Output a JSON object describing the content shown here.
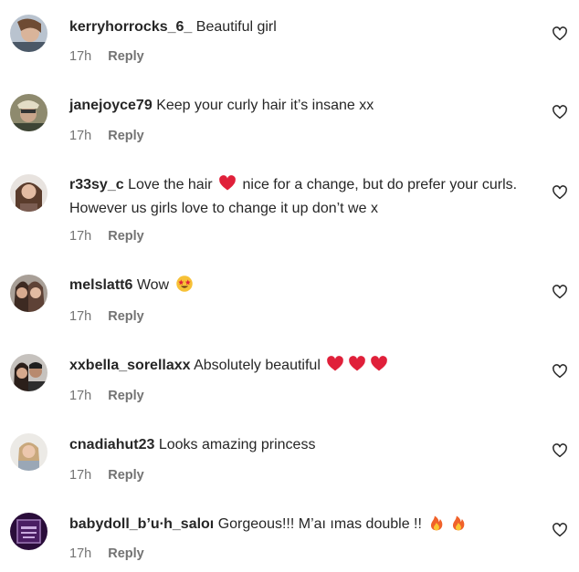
{
  "comments": [
    {
      "username": "kerryhorrocks_6_",
      "text": "Beautiful girl",
      "time": "17h",
      "reply_label": "Reply",
      "avatar_icon": "profile-photo",
      "like_icon": "heart-outline-icon"
    },
    {
      "username": "janejoyce79",
      "text": "Keep your curly hair it’s insane xx",
      "time": "17h",
      "reply_label": "Reply",
      "avatar_icon": "profile-photo",
      "like_icon": "heart-outline-icon"
    },
    {
      "username": "r33sy_c",
      "text_before_emoji": "Love the hair",
      "text_after_emoji": "nice for a change, but do prefer your curls. However us girls love to change it up don’t we x",
      "emoji_icon": "red-heart-emoji",
      "time": "17h",
      "reply_label": "Reply",
      "avatar_icon": "profile-photo",
      "like_icon": "heart-outline-icon"
    },
    {
      "username": "melslatt6",
      "text": "Wow",
      "emoji_icon": "star-struck-emoji",
      "time": "17h",
      "reply_label": "Reply",
      "avatar_icon": "profile-photo",
      "like_icon": "heart-outline-icon"
    },
    {
      "username": "xxbella_sorellaxx",
      "text": "Absolutely beautiful",
      "emoji_icons": [
        "red-heart-emoji",
        "red-heart-emoji",
        "red-heart-emoji"
      ],
      "time": "17h",
      "reply_label": "Reply",
      "avatar_icon": "profile-photo",
      "like_icon": "heart-outline-icon"
    },
    {
      "username": "cnadiahut23",
      "text": "Looks amazing princess",
      "time": "17h",
      "reply_label": "Reply",
      "avatar_icon": "profile-photo",
      "like_icon": "heart-outline-icon"
    },
    {
      "username": "babydoll_b’u∙h_saloı",
      "text": "Gorgeous!!! M’aı ımas double !!",
      "emoji_icons": [
        "fire-emoji",
        "fire-emoji"
      ],
      "time": "17h",
      "reply_label": "Reply",
      "avatar_icon": "profile-photo",
      "like_icon": "heart-outline-icon"
    }
  ],
  "colors": {
    "text": "#262626",
    "meta": "#737373",
    "heart_red": "#e0203a"
  }
}
